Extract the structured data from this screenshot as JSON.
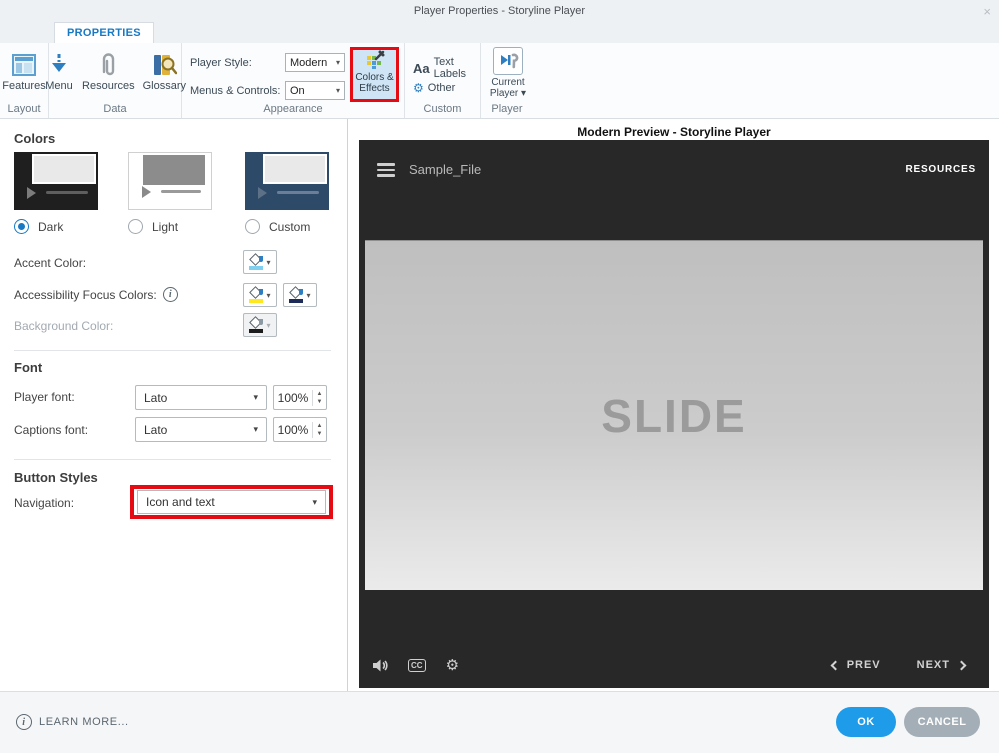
{
  "window": {
    "title": "Player Properties - Storyline Player",
    "close_glyph": "×"
  },
  "ribbon": {
    "tab_label": "PROPERTIES",
    "layout_group": {
      "features_label": "Features",
      "group_label": "Layout"
    },
    "data_group": {
      "menu_label": "Menu",
      "resources_label": "Resources",
      "glossary_label": "Glossary",
      "group_label": "Data"
    },
    "appearance_group": {
      "player_style_label": "Player Style:",
      "player_style_value": "Modern",
      "menus_controls_label": "Menus & Controls:",
      "menus_controls_value": "On",
      "colors_effects_line1": "Colors &",
      "colors_effects_line2": "Effects",
      "group_label": "Appearance"
    },
    "custom_group": {
      "aa_glyph": "Aa",
      "text_labels_label": "Text Labels",
      "other_label": "Other",
      "other_icon_glyph": "⚙",
      "group_label": "Custom"
    },
    "player_group": {
      "current_player_line1": "Current",
      "current_player_line2": "Player ▾",
      "group_label": "Player"
    }
  },
  "colors_section": {
    "heading": "Colors",
    "themes": [
      {
        "label": "Dark",
        "selected": true
      },
      {
        "label": "Light",
        "selected": false
      },
      {
        "label": "Custom",
        "selected": false
      }
    ],
    "accent_color_label": "Accent Color:",
    "accessibility_label": "Accessibility Focus Colors:",
    "background_label": "Background Color:",
    "info_glyph": "i",
    "swatch_styles": {
      "accent": "background:#7fd0f0",
      "focus_1": "background:#ffe81f",
      "focus_2": "background:#1c2b58",
      "background": "background:#1c1c1c"
    }
  },
  "font_section": {
    "heading": "Font",
    "player_font_label": "Player font:",
    "player_font_value": "Lato",
    "player_font_scale": "100%",
    "captions_font_label": "Captions font:",
    "captions_font_value": "Lato",
    "captions_font_scale": "100%"
  },
  "button_styles_section": {
    "heading": "Button Styles",
    "navigation_label": "Navigation:",
    "navigation_value": "Icon and text"
  },
  "preview": {
    "title": "Modern Preview - Storyline Player",
    "player_title": "Sample_File",
    "resources_label": "RESOURCES",
    "slide_label": "SLIDE",
    "cc_glyph": "CC",
    "gear_glyph": "⚙",
    "prev_label": "PREV",
    "next_label": "NEXT"
  },
  "footer": {
    "learn_more_label": "LEARN MORE...",
    "info_glyph": "i",
    "ok_label": "OK",
    "cancel_label": "CANCEL"
  },
  "theme_colors": {
    "accent_blue": "#1e9be9",
    "cancel_gray": "#a3aeb6",
    "highlight_red": "#e60b12",
    "player_background": "#282828",
    "dark_theme_thumb": "#1f1f1f",
    "custom_theme_thumb": "#2d4a68",
    "tab_blue": "#1779c4"
  }
}
